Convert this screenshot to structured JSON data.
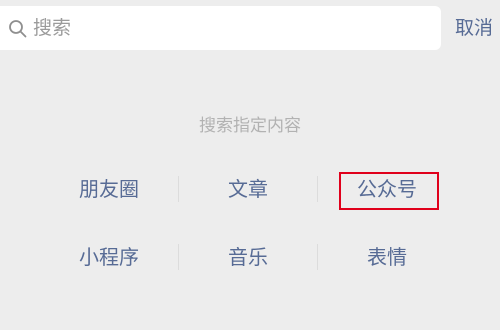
{
  "search": {
    "placeholder": "搜索",
    "cancel_label": "取消"
  },
  "section": {
    "title": "搜索指定内容"
  },
  "categories": {
    "row1": [
      "朋友圈",
      "文章",
      "公众号"
    ],
    "row2": [
      "小程序",
      "音乐",
      "表情"
    ]
  },
  "highlighted_item": "公众号",
  "colors": {
    "link": "#576b95",
    "background": "#ededed",
    "hint": "#b2b2b2",
    "highlight_border": "#e0001b"
  }
}
